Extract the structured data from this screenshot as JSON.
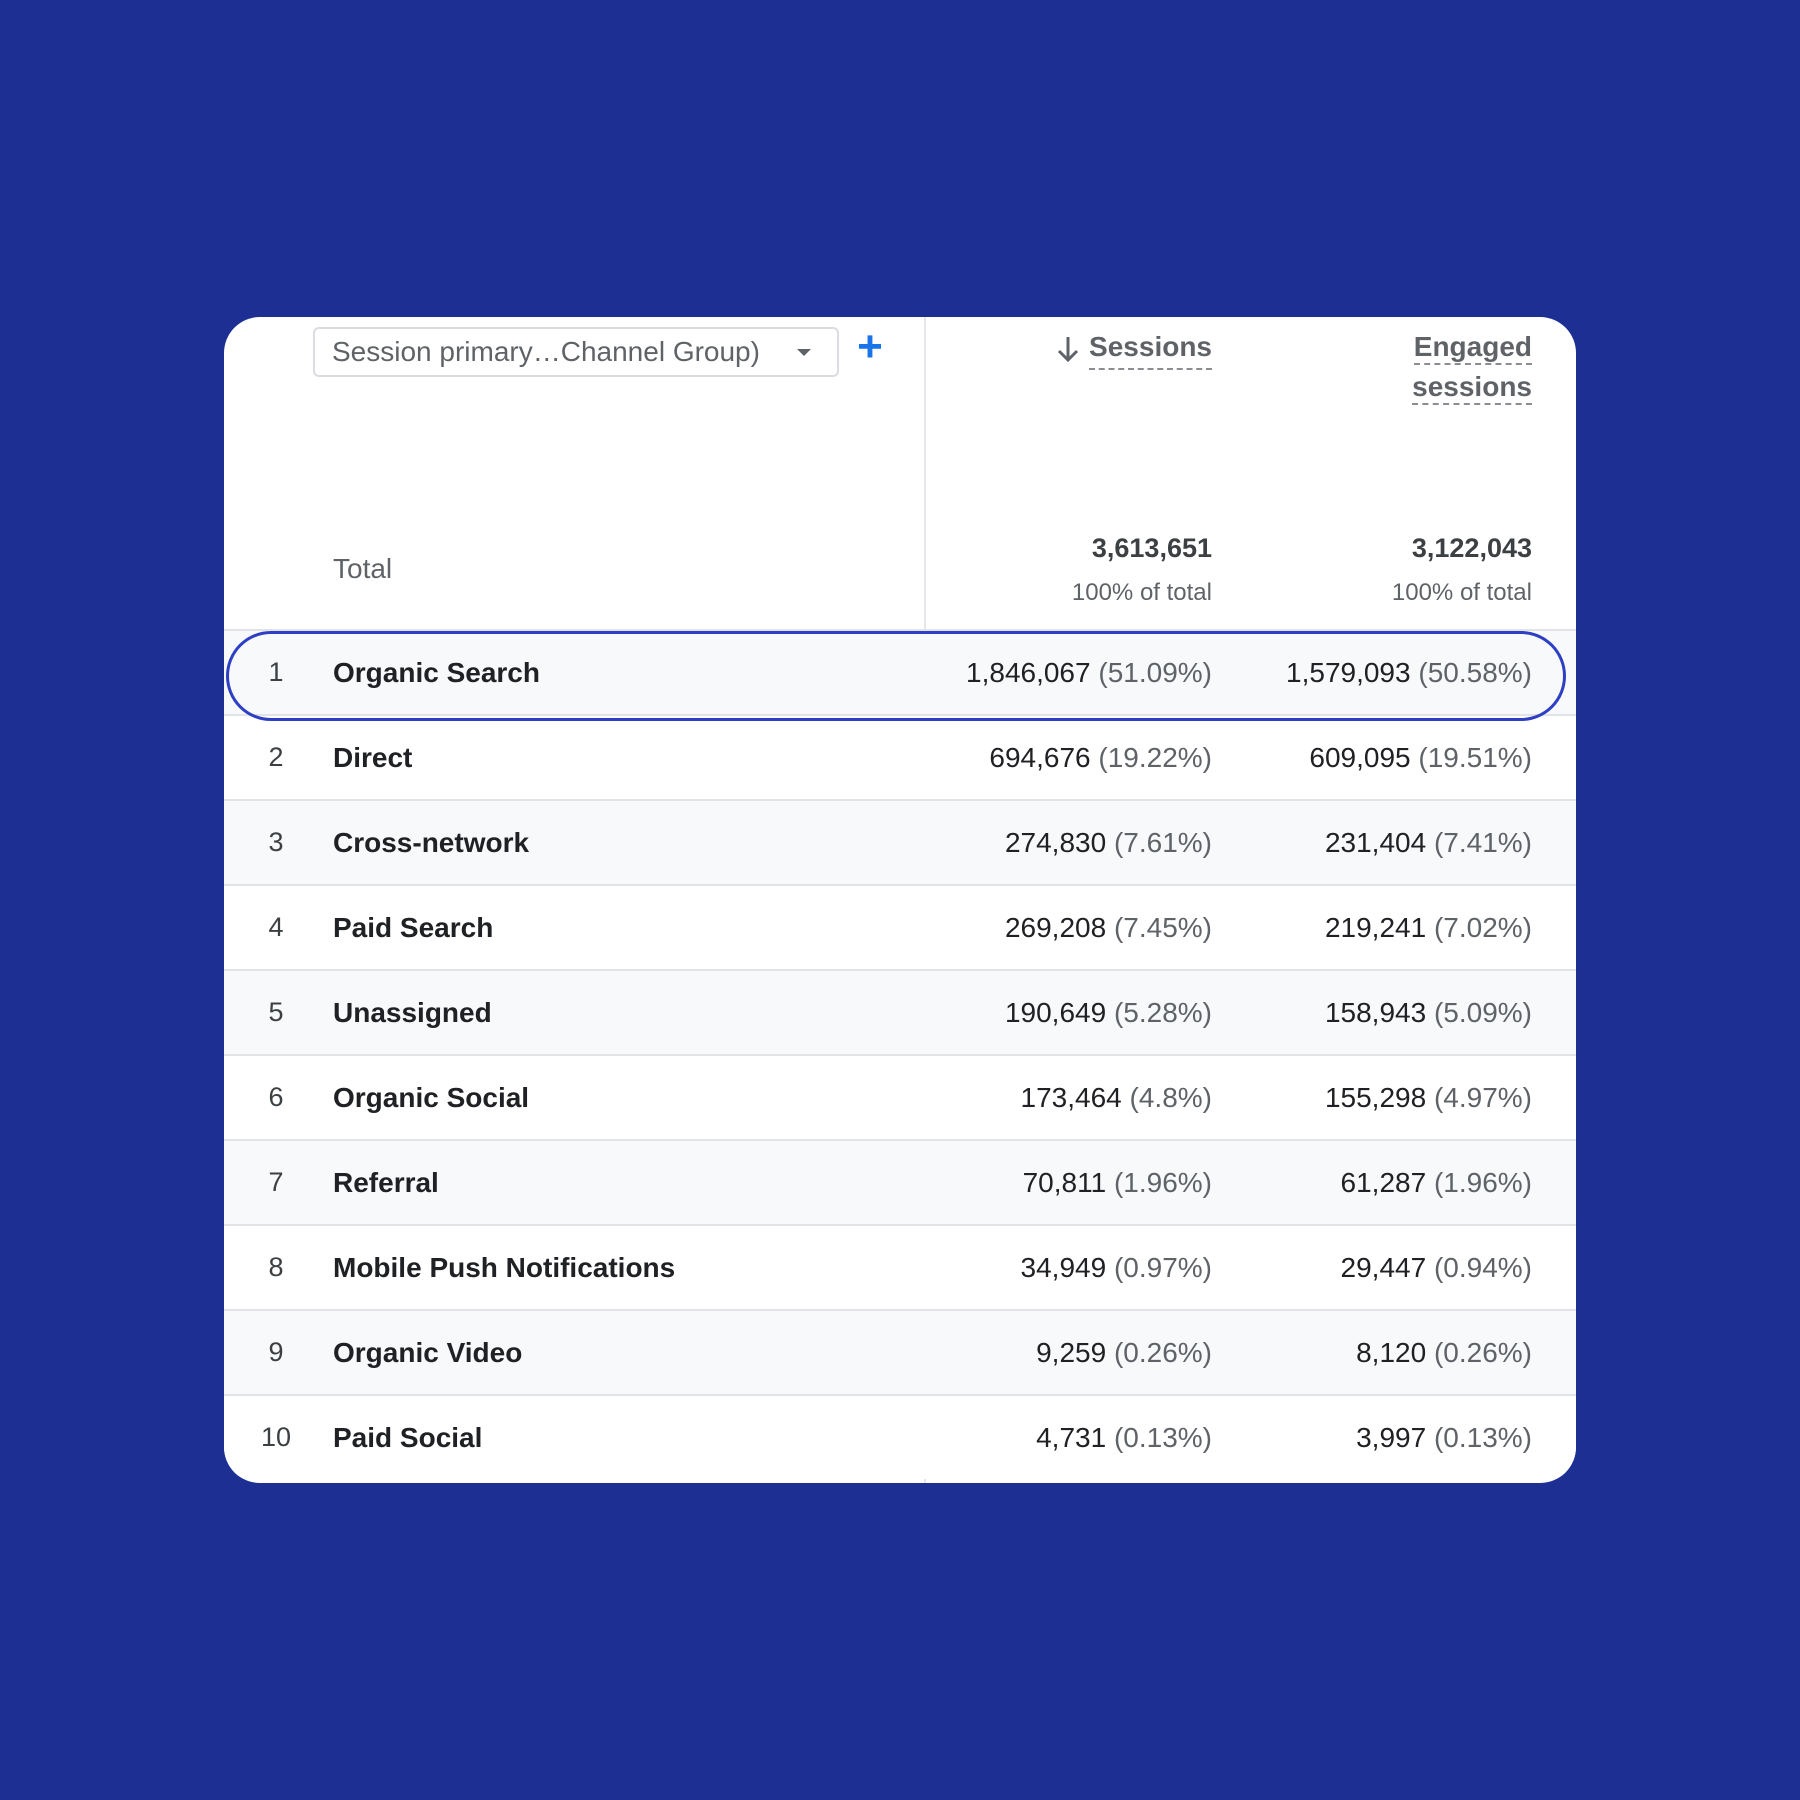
{
  "colors": {
    "background": "#1e2f93",
    "card": "#ffffff",
    "accent": "#1a73e8",
    "highlight_outline": "#2d3fc4"
  },
  "header": {
    "dimension_select_value": "Session primary…Channel Group)",
    "add_dimension_icon": "plus-icon",
    "sort_icon": "arrow-down-icon",
    "metric_sessions": "Sessions",
    "metric_engaged_line1": "Engaged",
    "metric_engaged_line2": "sessions"
  },
  "totals": {
    "label": "Total",
    "sessions": "3,613,651",
    "sessions_pct": "100% of total",
    "engaged": "3,122,043",
    "engaged_pct": "100% of total"
  },
  "rows": [
    {
      "idx": "1",
      "name": "Organic Search",
      "sessions": "1,846,067",
      "sessions_pct": "(51.09%)",
      "engaged": "1,579,093",
      "engaged_pct": "(50.58%)"
    },
    {
      "idx": "2",
      "name": "Direct",
      "sessions": "694,676",
      "sessions_pct": "(19.22%)",
      "engaged": "609,095",
      "engaged_pct": "(19.51%)"
    },
    {
      "idx": "3",
      "name": "Cross-network",
      "sessions": "274,830",
      "sessions_pct": "(7.61%)",
      "engaged": "231,404",
      "engaged_pct": "(7.41%)"
    },
    {
      "idx": "4",
      "name": "Paid Search",
      "sessions": "269,208",
      "sessions_pct": "(7.45%)",
      "engaged": "219,241",
      "engaged_pct": "(7.02%)"
    },
    {
      "idx": "5",
      "name": "Unassigned",
      "sessions": "190,649",
      "sessions_pct": "(5.28%)",
      "engaged": "158,943",
      "engaged_pct": "(5.09%)"
    },
    {
      "idx": "6",
      "name": "Organic Social",
      "sessions": "173,464",
      "sessions_pct": "(4.8%)",
      "engaged": "155,298",
      "engaged_pct": "(4.97%)"
    },
    {
      "idx": "7",
      "name": "Referral",
      "sessions": "70,811",
      "sessions_pct": "(1.96%)",
      "engaged": "61,287",
      "engaged_pct": "(1.96%)"
    },
    {
      "idx": "8",
      "name": "Mobile Push Notifications",
      "sessions": "34,949",
      "sessions_pct": "(0.97%)",
      "engaged": "29,447",
      "engaged_pct": "(0.94%)"
    },
    {
      "idx": "9",
      "name": "Organic Video",
      "sessions": "9,259",
      "sessions_pct": "(0.26%)",
      "engaged": "8,120",
      "engaged_pct": "(0.26%)"
    },
    {
      "idx": "10",
      "name": "Paid Social",
      "sessions": "4,731",
      "sessions_pct": "(0.13%)",
      "engaged": "3,997",
      "engaged_pct": "(0.13%)"
    }
  ]
}
